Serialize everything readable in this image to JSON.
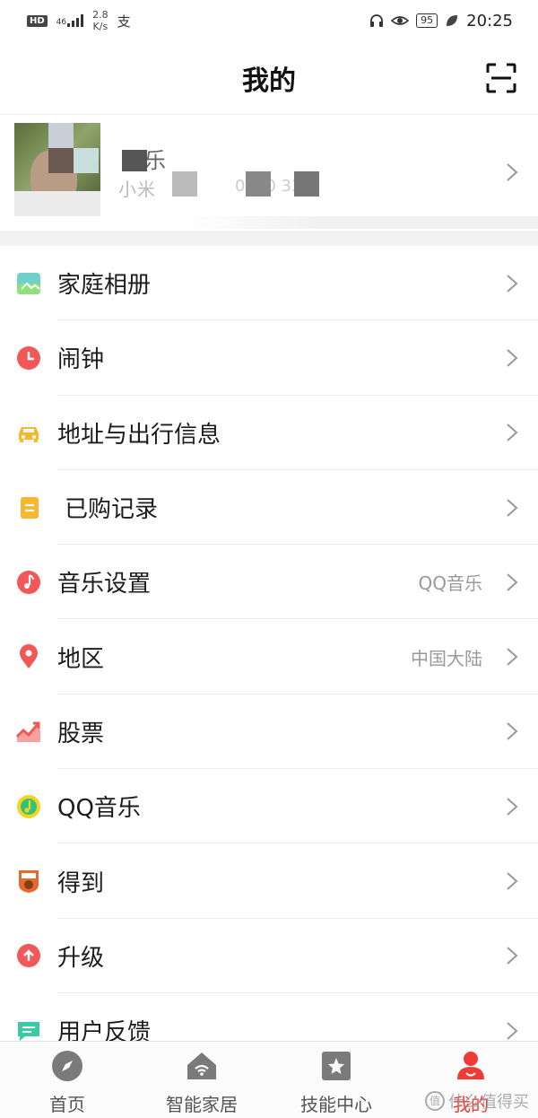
{
  "status_bar": {
    "hd": "HD",
    "signal": "46",
    "speed_top": "2.8",
    "speed_bottom": "K/s",
    "alipay_icon": "支",
    "battery": "95",
    "time": "20:25"
  },
  "header": {
    "title": "我的"
  },
  "profile": {
    "name": "乐乐",
    "sub": "小米",
    "id_fragment": "0270 33"
  },
  "menu": [
    {
      "label": "家庭相册",
      "icon": "photo-album-icon",
      "value": ""
    },
    {
      "label": "闹钟",
      "icon": "alarm-clock-icon",
      "value": ""
    },
    {
      "label": "地址与出行信息",
      "icon": "car-icon",
      "value": ""
    },
    {
      "label": "已购记录",
      "icon": "purchase-record-icon",
      "value": ""
    },
    {
      "label": "音乐设置",
      "icon": "music-note-icon",
      "value": "QQ音乐"
    },
    {
      "label": "地区",
      "icon": "location-pin-icon",
      "value": "中国大陆"
    },
    {
      "label": "股票",
      "icon": "stock-chart-icon",
      "value": ""
    },
    {
      "label": "QQ音乐",
      "icon": "qq-music-icon",
      "value": ""
    },
    {
      "label": "得到",
      "icon": "dedao-icon",
      "value": ""
    },
    {
      "label": "升级",
      "icon": "upgrade-icon",
      "value": ""
    },
    {
      "label": "用户反馈",
      "icon": "feedback-icon",
      "value": ""
    }
  ],
  "tabs": [
    {
      "label": "首页",
      "icon": "compass-icon",
      "active": false
    },
    {
      "label": "智能家居",
      "icon": "smart-home-icon",
      "active": false
    },
    {
      "label": "技能中心",
      "icon": "skill-star-icon",
      "active": false
    },
    {
      "label": "我的",
      "icon": "profile-icon",
      "active": true
    }
  ],
  "watermark": {
    "badge": "值",
    "text": "什么值得买"
  },
  "colors": {
    "accent": "#ee3b36",
    "divider": "#ececec",
    "gray_text": "#999999"
  }
}
